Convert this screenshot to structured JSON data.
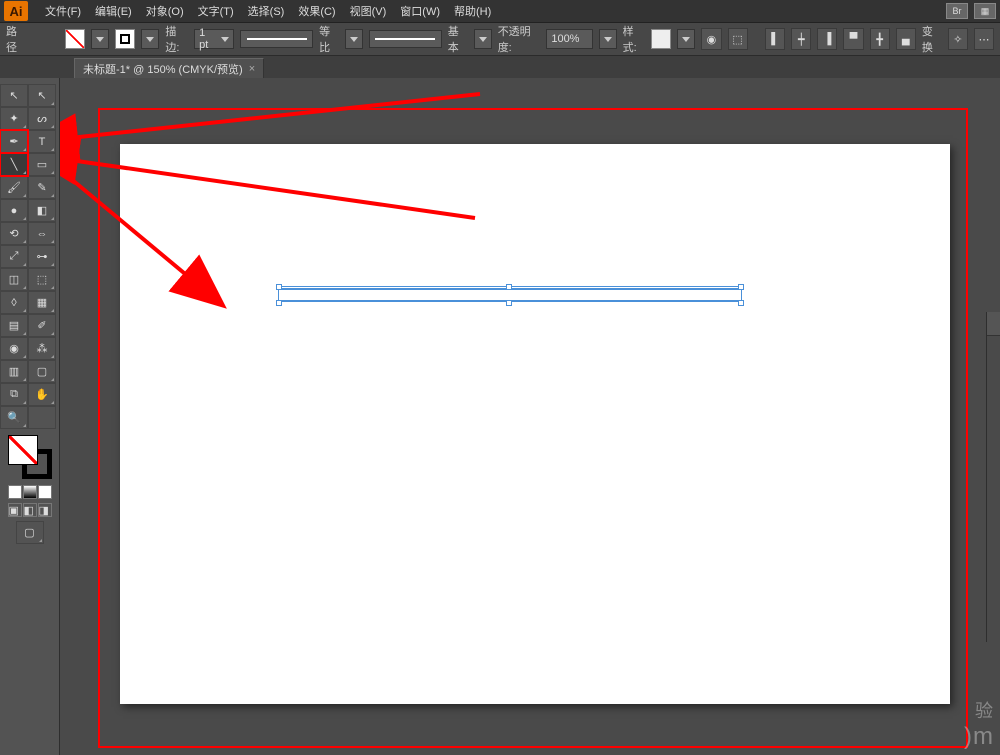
{
  "app": {
    "logo": "Ai"
  },
  "menu": {
    "items": [
      "文件(F)",
      "编辑(E)",
      "对象(O)",
      "文字(T)",
      "选择(S)",
      "效果(C)",
      "视图(V)",
      "窗口(W)",
      "帮助(H)"
    ],
    "right": [
      "Br",
      "▦"
    ]
  },
  "control": {
    "path_label": "路径",
    "stroke_label": "描边:",
    "stroke_weight": "1 pt",
    "profile1": "等比",
    "profile2": "基本",
    "opacity_label": "不透明度:",
    "opacity_value": "100%",
    "style_label": "样式:",
    "transform_label": "变换"
  },
  "tab": {
    "title": "未标题-1* @ 150% (CMYK/预览)",
    "close": "×"
  },
  "tools": [
    [
      {
        "n": "selection",
        "g": "↖",
        "t": false
      },
      {
        "n": "direct-select",
        "g": "↖",
        "t": true
      }
    ],
    [
      {
        "n": "magic-wand",
        "g": "✦",
        "t": true
      },
      {
        "n": "lasso",
        "g": "ᔕ",
        "t": true
      }
    ],
    [
      {
        "n": "pen",
        "g": "✒",
        "t": true,
        "hi": true
      },
      {
        "n": "type",
        "g": "T",
        "t": true
      }
    ],
    [
      {
        "n": "line",
        "g": "╲",
        "t": true,
        "hi": true,
        "sel": true
      },
      {
        "n": "rectangle",
        "g": "▭",
        "t": true
      }
    ],
    [
      {
        "n": "paintbrush",
        "g": "🖌",
        "t": true
      },
      {
        "n": "pencil",
        "g": "✎",
        "t": true
      }
    ],
    [
      {
        "n": "blob-brush",
        "g": "●",
        "t": true
      },
      {
        "n": "eraser",
        "g": "◧",
        "t": true
      }
    ],
    [
      {
        "n": "rotate",
        "g": "⟲",
        "t": true
      },
      {
        "n": "reflect",
        "g": "⇔",
        "t": true
      }
    ],
    [
      {
        "n": "scale",
        "g": "⤢",
        "t": true
      },
      {
        "n": "width",
        "g": "⊶",
        "t": true
      }
    ],
    [
      {
        "n": "free-transform",
        "g": "◫",
        "t": true
      },
      {
        "n": "shape-builder",
        "g": "⬚",
        "t": true
      }
    ],
    [
      {
        "n": "perspective",
        "g": "◊",
        "t": true
      },
      {
        "n": "mesh",
        "g": "▦",
        "t": true
      }
    ],
    [
      {
        "n": "gradient",
        "g": "▤",
        "t": true
      },
      {
        "n": "eyedropper",
        "g": "✐",
        "t": true
      }
    ],
    [
      {
        "n": "blend",
        "g": "◉",
        "t": true
      },
      {
        "n": "symbol-spray",
        "g": "⁂",
        "t": true
      }
    ],
    [
      {
        "n": "column-graph",
        "g": "▥",
        "t": true
      },
      {
        "n": "artboard",
        "g": "▢",
        "t": true
      }
    ],
    [
      {
        "n": "slice",
        "g": "⧉",
        "t": true
      },
      {
        "n": "hand",
        "g": "✋",
        "t": true
      }
    ],
    [
      {
        "n": "zoom",
        "g": "🔍",
        "t": true
      },
      {
        "n": "",
        "g": "",
        "t": false
      }
    ]
  ],
  "watermark": {
    "ch": "验",
    "en": ")m"
  }
}
